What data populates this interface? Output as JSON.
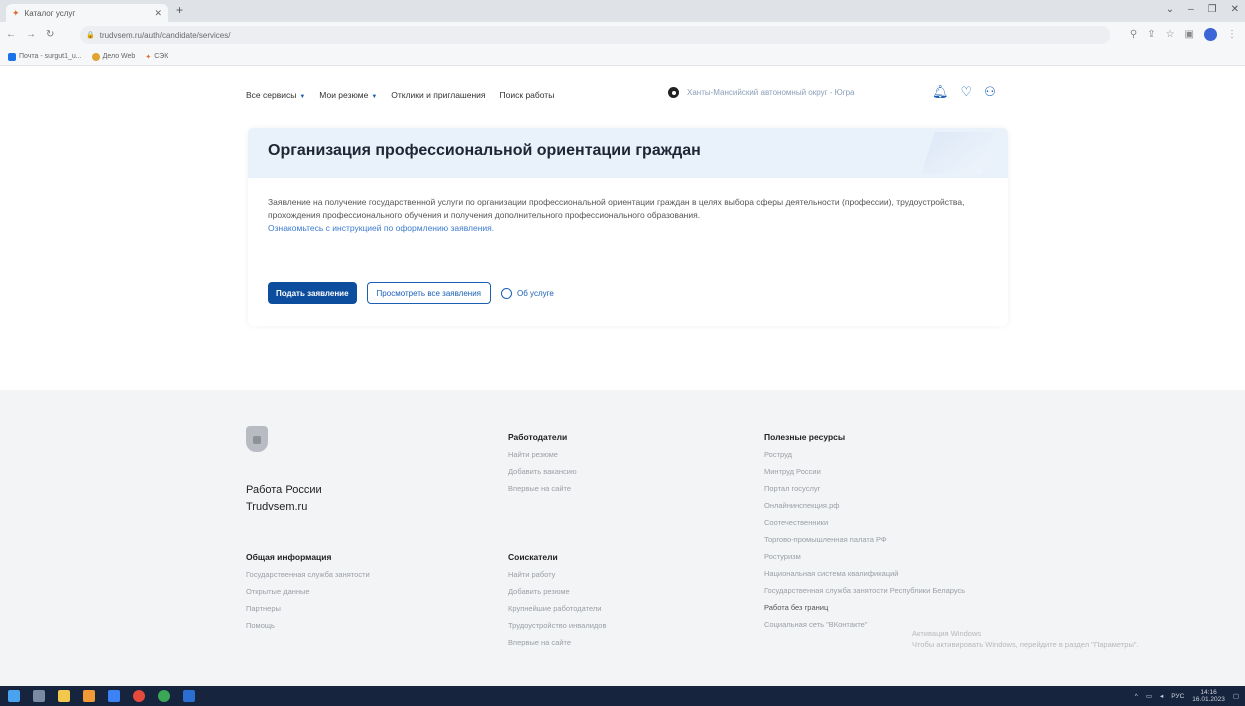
{
  "browser": {
    "tab_title": "Каталог услуг",
    "url": "trudvsem.ru/auth/candidate/services/",
    "bookmarks": [
      "Почта - surgut1_u...",
      "Дело Web",
      "СЭК"
    ]
  },
  "header": {
    "nav": [
      "Все сервисы",
      "Мои резюме",
      "Отклики и приглашения",
      "Поиск работы"
    ],
    "region": "Ханты-Мансийский автономный округ - Югра"
  },
  "card": {
    "title": "Организация профессиональной ориентации граждан",
    "description": "Заявление на получение государственной услуги по организации профессиональной ориентации граждан в целях выбора сферы деятельности (профессии), трудоустройства, прохождения профессионального обучения и получения дополнительного профессионального образования.",
    "instruction_link": "Ознакомьтесь с инструкцией по оформлению заявления.",
    "submit_label": "Подать заявление",
    "view_all_label": "Просмотреть все заявления",
    "about_label": "Об услуге"
  },
  "footer": {
    "brand_line1": "Работа России",
    "brand_line2": "Trudvsem.ru",
    "general": {
      "title": "Общая информация",
      "links": [
        "Государственная служба занятости",
        "Открытые данные",
        "Партнеры",
        "Помощь"
      ]
    },
    "employers": {
      "title": "Работодатели",
      "links": [
        "Найти резюме",
        "Добавить вакансию",
        "Впервые на сайте"
      ]
    },
    "seekers": {
      "title": "Соискатели",
      "links": [
        "Найти работу",
        "Добавить резюме",
        "Крупнейшие работодатели",
        "Трудоустройство инвалидов",
        "Впервые на сайте"
      ]
    },
    "resources": {
      "title": "Полезные ресурсы",
      "links": [
        "Роструд",
        "Минтруд России",
        "Портал госуслуг",
        "Онлайнинспекция.рф",
        "Соотечественники",
        "Торгово-промышленная палата РФ",
        "Ростуризм",
        "Национальная система квалификаций",
        "Государственная служба занятости Республики Беларусь",
        "Работа без границ",
        "Социальная сеть \"ВКонтакте\""
      ]
    },
    "watermark_line1": "Активация Windows",
    "watermark_line2": "Чтобы активировать Windows, перейдите в раздел \"Параметры\"."
  },
  "taskbar": {
    "lang": "РУС",
    "time": "14:16",
    "date": "16.01.2023"
  }
}
